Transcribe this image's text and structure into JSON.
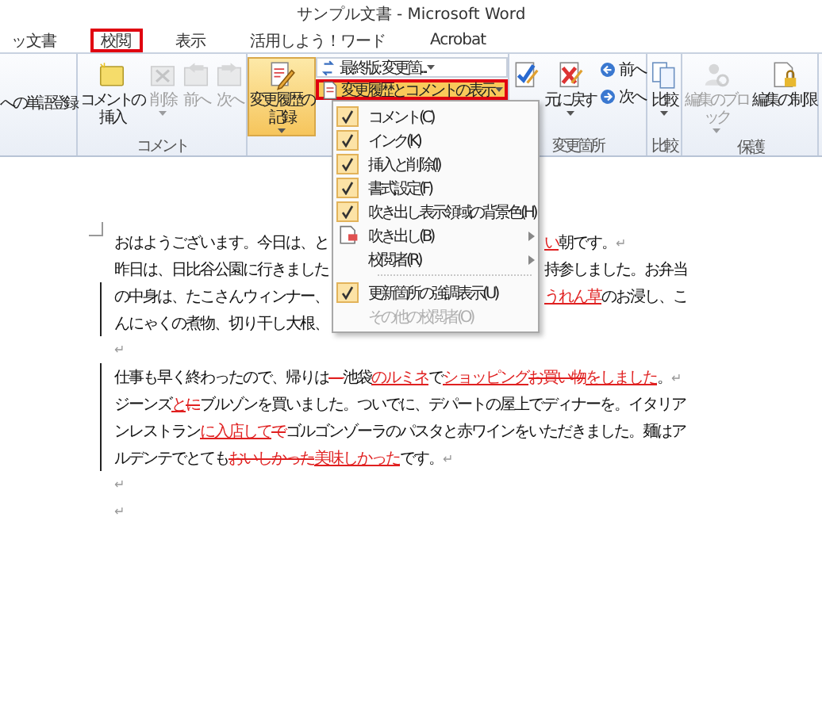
{
  "window": {
    "title": "サンプル文書 - Microsoft Word"
  },
  "tabs": [
    {
      "label": "ッ文書",
      "selected": false
    },
    {
      "label": "校閲",
      "selected": true
    },
    {
      "label": "表示",
      "selected": false
    },
    {
      "label": "活用しよう！ワード",
      "selected": false
    },
    {
      "label": "Acrobat",
      "selected": false
    }
  ],
  "ribbon": {
    "groups": [
      {
        "items": [
          {
            "kind": "text",
            "label": "への単語登録"
          }
        ]
      },
      {
        "label": "コメント",
        "items": [
          {
            "kind": "large",
            "label": "コメントの挿入",
            "disabled": false,
            "caret": false
          },
          {
            "kind": "large",
            "label": "削除",
            "disabled": true,
            "caret": true
          },
          {
            "kind": "large",
            "label": "前へ",
            "disabled": true,
            "caret": false
          },
          {
            "kind": "large",
            "label": "次へ",
            "disabled": true,
            "caret": false
          }
        ]
      },
      {
        "items": [
          {
            "kind": "large",
            "label": "変更履歴の記録",
            "disabled": false,
            "highlighted": true,
            "caret": true
          },
          {
            "kind": "stack",
            "entries": [
              {
                "label": "最終版: 変更箇...",
                "highlighted": false
              },
              {
                "label": "変更履歴とコメントの表示",
                "highlighted": true
              }
            ]
          }
        ]
      },
      {
        "label": "変更箇所",
        "items": [
          {
            "kind": "large",
            "disabled": false,
            "caret": false
          },
          {
            "kind": "large",
            "label": "元に戻す",
            "disabled": false,
            "caret": true
          },
          {
            "kind": "smallpair",
            "entries": [
              {
                "label": "前へ"
              },
              {
                "label": "次へ"
              }
            ]
          }
        ]
      },
      {
        "label": "比較",
        "items": [
          {
            "kind": "large",
            "label": "比較",
            "disabled": false,
            "caret": true
          }
        ]
      },
      {
        "label": "保護",
        "items": [
          {
            "kind": "large",
            "label": "編集のブロック",
            "disabled": true,
            "caret": true
          },
          {
            "kind": "large",
            "label": "編集の制限",
            "disabled": false,
            "caret": false
          }
        ]
      }
    ]
  },
  "menu": {
    "items": [
      {
        "kind": "check",
        "label": "コメント(C)",
        "checked": true,
        "disabled": false
      },
      {
        "kind": "check",
        "label": "インク(K)",
        "checked": true,
        "disabled": false
      },
      {
        "kind": "check",
        "label": "挿入と削除(I)",
        "checked": true,
        "disabled": false
      },
      {
        "kind": "check",
        "label": "書式設定(F)",
        "checked": true,
        "disabled": false
      },
      {
        "kind": "check",
        "label": "吹き出し表示領域の背景色(H)",
        "checked": true,
        "disabled": false
      },
      {
        "kind": "submenu",
        "label": "吹き出し(B)",
        "disabled": false
      },
      {
        "kind": "submenu",
        "label": "校閲者(R)",
        "disabled": false
      },
      {
        "kind": "separator"
      },
      {
        "kind": "check",
        "label": "更新箇所の強調表示(U)",
        "checked": true,
        "disabled": false
      },
      {
        "kind": "check",
        "label": "その他の校閲者(O)",
        "checked": false,
        "disabled": true
      }
    ]
  },
  "document": {
    "lines": [
      {
        "changed": false,
        "left": [
          {
            "kind": "plain",
            "text": "おはようございます。今日は、と"
          }
        ],
        "right": [
          {
            "kind": "insert",
            "text": "い"
          },
          {
            "kind": "plain",
            "text": "朝です。"
          },
          {
            "kind": "mark",
            "text": "↵"
          }
        ]
      },
      {
        "changed": false,
        "left": [
          {
            "kind": "plain",
            "text": "昨日は、日比谷公園に行きました"
          }
        ],
        "right": [
          {
            "kind": "plain",
            "text": "持参しました。お弁当"
          }
        ]
      },
      {
        "changed": true,
        "left": [
          {
            "kind": "plain",
            "text": "の中身は、たこさんウィンナー、"
          }
        ],
        "right": [
          {
            "kind": "insert",
            "text": "うれん草"
          },
          {
            "kind": "plain",
            "text": "のお浸し、こ"
          }
        ]
      },
      {
        "changed": true,
        "left": [
          {
            "kind": "plain",
            "text": "んにゃくの煮物、切り干し大根、"
          }
        ]
      },
      {
        "changed": false,
        "left": [
          {
            "kind": "mark",
            "text": "↵"
          }
        ]
      },
      {
        "changed": true,
        "left": [
          {
            "kind": "plain",
            "text": "仕事も早く終わったので、帰りは"
          },
          {
            "kind": "delete",
            "text": "―"
          },
          {
            "kind": "plain",
            "text": "池袋"
          },
          {
            "kind": "insert",
            "text": "のルミネ"
          },
          {
            "kind": "plain",
            "text": "で"
          },
          {
            "kind": "insert",
            "text": "ショッピング"
          },
          {
            "kind": "delete",
            "text": "お買い物"
          },
          {
            "kind": "insert",
            "text": "をしました"
          },
          {
            "kind": "plain",
            "text": "。"
          },
          {
            "kind": "mark",
            "text": "↵"
          }
        ]
      },
      {
        "changed": true,
        "left": [
          {
            "kind": "plain",
            "text": "ジーンズ"
          },
          {
            "kind": "insert",
            "text": "と"
          },
          {
            "kind": "delete",
            "text": "に"
          },
          {
            "kind": "plain",
            "text": "ブルゾンを買いました。ついでに、デパートの屋上でディナーを。イタリア"
          }
        ]
      },
      {
        "changed": true,
        "left": [
          {
            "kind": "plain",
            "text": "ンレストラン"
          },
          {
            "kind": "insert",
            "text": "に入店して"
          },
          {
            "kind": "delete",
            "text": "で"
          },
          {
            "kind": "plain",
            "text": "ゴルゴンゾーラのパスタと赤ワインをいただきました。麺はア"
          }
        ]
      },
      {
        "changed": true,
        "left": [
          {
            "kind": "plain",
            "text": "ルデンテでとても"
          },
          {
            "kind": "delete",
            "text": "おいしかった"
          },
          {
            "kind": "insert",
            "text": "美味しかった"
          },
          {
            "kind": "plain",
            "text": "です。"
          },
          {
            "kind": "mark",
            "text": "↵"
          }
        ]
      },
      {
        "changed": false,
        "left": [
          {
            "kind": "mark",
            "text": "↵"
          }
        ]
      },
      {
        "changed": false,
        "left": [
          {
            "kind": "mark",
            "text": "↵"
          }
        ]
      }
    ]
  }
}
